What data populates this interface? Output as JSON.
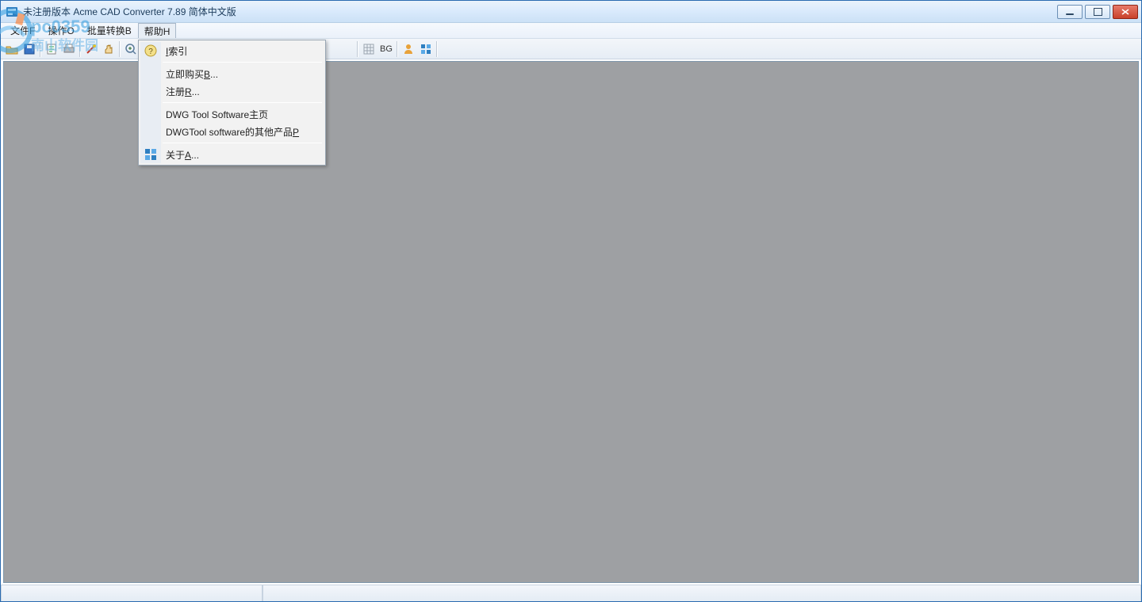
{
  "window": {
    "title": "未注册版本 Acme CAD Converter 7.89 简体中文版"
  },
  "menubar": {
    "items": [
      {
        "label": "文件F"
      },
      {
        "label": "操作O"
      },
      {
        "label": "批量转换B"
      },
      {
        "label": "帮助H"
      }
    ],
    "open_index": 3
  },
  "toolbar": {
    "bg_label": "BG"
  },
  "help_menu": {
    "items": [
      {
        "label_pre": "",
        "mn": "I",
        "label_post": "索引",
        "icon": "help"
      },
      {
        "sep": true
      },
      {
        "label_pre": "立即购买",
        "mn": "B",
        "label_post": "...",
        "icon": "none"
      },
      {
        "label_pre": "注册",
        "mn": "R",
        "label_post": "...",
        "icon": "none"
      },
      {
        "sep": true
      },
      {
        "label_pre": "DWG Tool Software主页",
        "mn": "",
        "label_post": "",
        "icon": "none"
      },
      {
        "label_pre": "DWGTool software的其他产品",
        "mn": "P",
        "label_post": "",
        "icon": "none"
      },
      {
        "sep": true
      },
      {
        "label_pre": "关于",
        "mn": "A",
        "label_post": "...",
        "icon": "about"
      }
    ]
  },
  "watermark": {
    "text1": "pc0359",
    "text2": "南山软件园"
  }
}
